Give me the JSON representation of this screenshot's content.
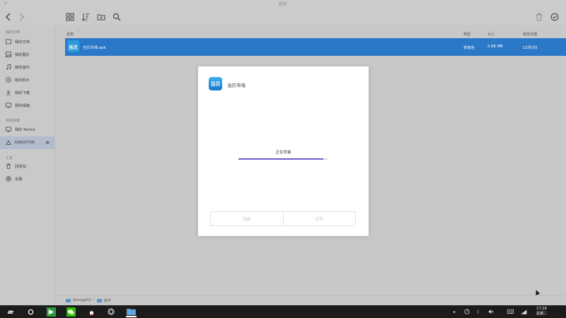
{
  "window": {
    "title": "软件"
  },
  "sidebar": {
    "sections": [
      {
        "header": "我的文档"
      },
      {
        "header": "存储设备"
      },
      {
        "header": "工具"
      }
    ],
    "items": [
      {
        "label": "我的文档",
        "icon": "document-icon"
      },
      {
        "label": "我的图片",
        "icon": "image-icon"
      },
      {
        "label": "我的音乐",
        "icon": "music-icon"
      },
      {
        "label": "我的影片",
        "icon": "video-icon"
      },
      {
        "label": "我的下载",
        "icon": "download-icon"
      },
      {
        "label": "我的桌面",
        "icon": "desktop-icon"
      },
      {
        "label": "我的 Remix",
        "icon": "computer-icon"
      },
      {
        "label": "KINGSTON",
        "icon": "usb-drive-icon",
        "selected": true
      },
      {
        "label": "回收站",
        "icon": "trash-icon"
      },
      {
        "label": "设置",
        "icon": "settings-icon"
      }
    ]
  },
  "columns": {
    "name": "名称",
    "type": "类型",
    "size": "大小",
    "modified": "修改日期"
  },
  "files": [
    {
      "name": "当贝市场.apk",
      "type": "安装包",
      "size": "5.68 MB",
      "modified": "12月3日",
      "icon_text": "当贝"
    }
  ],
  "statusbar": {
    "crumbs": [
      "Storage01",
      "软件"
    ]
  },
  "dialog": {
    "app_name": "当贝市场",
    "icon_text": "当贝",
    "status": "正在安装",
    "progress": 0.95,
    "buttons": {
      "done": "完成",
      "open": "打开"
    }
  },
  "taskbar": {
    "clock_time": "17:29",
    "clock_day": "星期二",
    "start_logo": "Remix-logo"
  },
  "colors": {
    "accent": "#2c78c8",
    "progress": "#6c5fc7",
    "taskbar": "#1b1b1b"
  }
}
